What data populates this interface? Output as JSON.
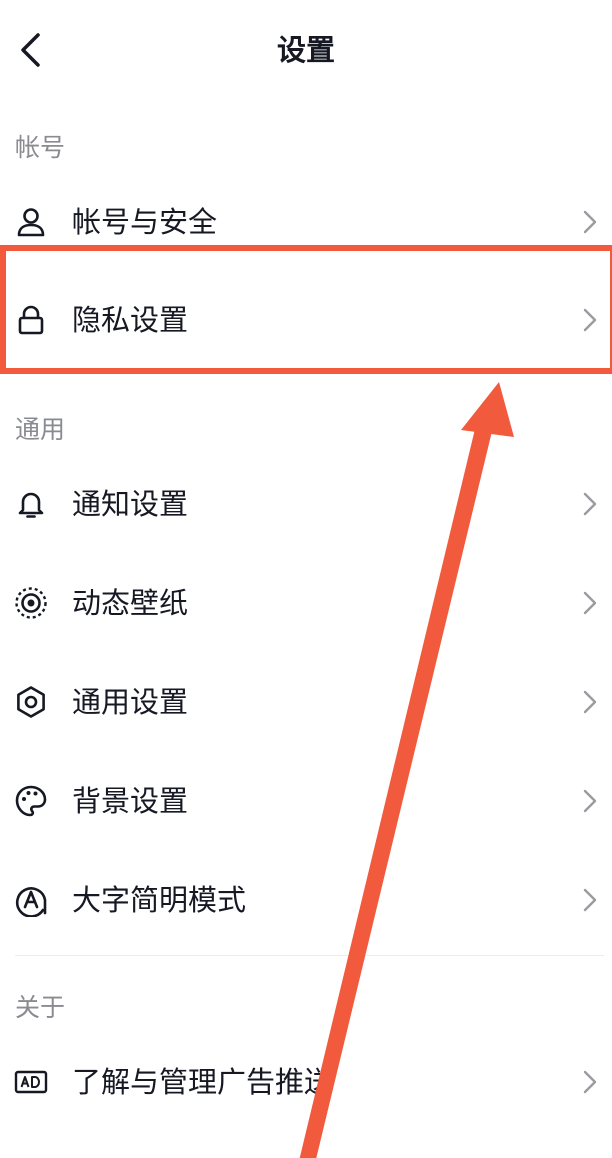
{
  "header": {
    "title": "设置",
    "back_icon": "chevron-left-icon"
  },
  "sections": [
    {
      "label": "帐号",
      "items": [
        {
          "label": "帐号与安全",
          "icon": "user-icon"
        },
        {
          "label": "隐私设置",
          "icon": "lock-icon"
        }
      ]
    },
    {
      "label": "通用",
      "items": [
        {
          "label": "通知设置",
          "icon": "bell-icon"
        },
        {
          "label": "动态壁纸",
          "icon": "live-wallpaper-icon"
        },
        {
          "label": "通用设置",
          "icon": "gear-icon"
        },
        {
          "label": "背景设置",
          "icon": "palette-icon"
        },
        {
          "label": "大字简明模式",
          "icon": "large-text-icon"
        }
      ]
    },
    {
      "label": "关于",
      "items": [
        {
          "label": "了解与管理广告推送",
          "icon": "ad-icon"
        }
      ]
    }
  ],
  "annotation": {
    "highlight_color": "#f15a3c",
    "highlighted_item": "隐私设置"
  }
}
